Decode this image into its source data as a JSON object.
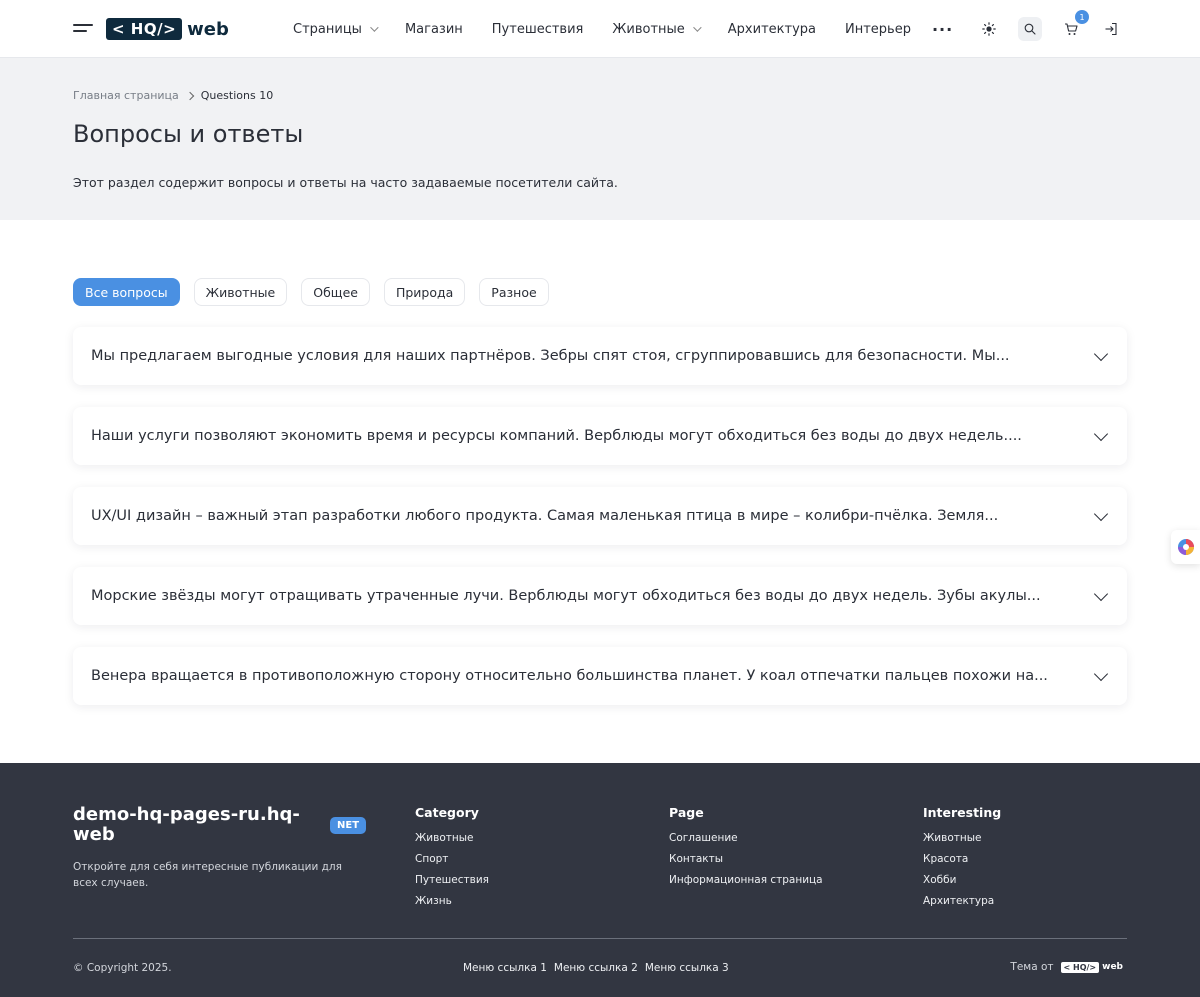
{
  "header": {
    "logo_box": "< HQ/>",
    "logo_text": "web",
    "nav": [
      {
        "label": "Страницы",
        "dropdown": true
      },
      {
        "label": "Магазин",
        "dropdown": false
      },
      {
        "label": "Путешествия",
        "dropdown": false
      },
      {
        "label": "Животные",
        "dropdown": true
      },
      {
        "label": "Архитектура",
        "dropdown": false
      },
      {
        "label": "Интерьер",
        "dropdown": false
      }
    ],
    "more": "···",
    "cart_count": "1",
    "icons": [
      "burger-menu-icon",
      "sun-icon",
      "search-icon",
      "cart-icon",
      "login-icon"
    ]
  },
  "breadcrumb": {
    "home": "Главная страница",
    "current": "Questions 10"
  },
  "page": {
    "title": "Вопросы и ответы",
    "description": "Этот раздел содержит вопросы и ответы на часто задаваемые посетители сайта."
  },
  "filters": [
    {
      "label": "Все вопросы",
      "active": true
    },
    {
      "label": "Животные",
      "active": false
    },
    {
      "label": "Общее",
      "active": false
    },
    {
      "label": "Природа",
      "active": false
    },
    {
      "label": "Разное",
      "active": false
    }
  ],
  "faq": [
    "Мы предлагаем выгодные условия для наших партнёров. Зебры спят стоя, сгруппировавшись для безопасности. Мы...",
    "Наши услуги позволяют экономить время и ресурсы компаний. Верблюды могут обходиться без воды до двух недель....",
    "UX/UI дизайн – важный этап разработки любого продукта. Самая маленькая птица в мире – колибри-пчёлка. Земля...",
    "Морские звёзды могут отращивать утраченные лучи. Верблюды могут обходиться без воды до двух недель. Зубы акулы...",
    "Венера вращается в противоположную сторону относительно большинства планет. У коал отпечатки пальцев похожи на..."
  ],
  "footer": {
    "brand": "demo-hq-pages-ru.hq-web",
    "badge": "NET",
    "description": "Откройте для себя интересные публикации для всех случаев.",
    "columns": [
      {
        "title": "Category",
        "links": [
          "Животные",
          "Спорт",
          "Путешествия",
          "Жизнь"
        ]
      },
      {
        "title": "Page",
        "links": [
          "Соглашение",
          "Контакты",
          "Информационная страница"
        ]
      },
      {
        "title": "Interesting",
        "links": [
          "Животные",
          "Красота",
          "Хобби",
          "Архитектура"
        ]
      }
    ],
    "copyright": "© Copyright 2025.",
    "menu_links": [
      "Меню ссылка 1",
      "Меню ссылка 2",
      "Меню ссылка 3"
    ],
    "theme_by": "Тема от",
    "theme_logo_box": "< HQ/>",
    "theme_logo_text": "web"
  },
  "colors": {
    "accent": "#4a90e2",
    "dark": "#0f2a3d",
    "footer_bg": "#323641",
    "hero_bg": "#f1f2f4"
  }
}
